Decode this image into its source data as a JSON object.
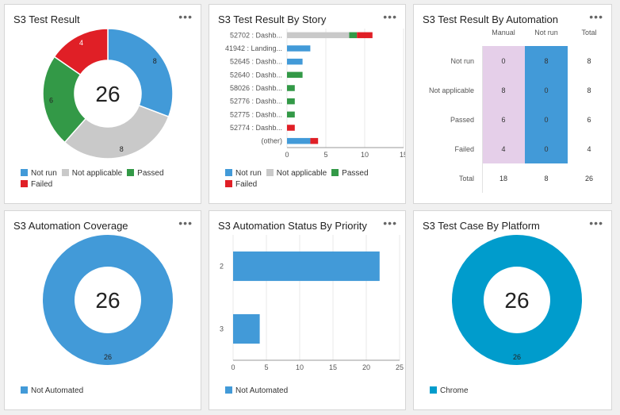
{
  "colors": {
    "not_run": "#429ad8",
    "not_applicable": "#c9c9c9",
    "passed": "#339947",
    "failed": "#e01f26",
    "not_automated": "#429ad8",
    "chrome": "#009ccc",
    "manual_cell": "#e5cfe9",
    "notrun_cell": "#429ad8"
  },
  "menu_icon": "more-horizontal-icon",
  "tiles": {
    "test_result": {
      "title": "S3 Test Result",
      "total": "26",
      "legend": [
        "Not run",
        "Not applicable",
        "Passed",
        "Failed"
      ]
    },
    "by_story": {
      "title": "S3 Test Result By Story",
      "legend": [
        "Not run",
        "Not applicable",
        "Passed",
        "Failed"
      ]
    },
    "by_automation": {
      "title": "S3 Test Result By Automation",
      "columns": [
        "Manual",
        "Not run",
        "Total"
      ],
      "rows": [
        {
          "label": "Not run",
          "manual": "0",
          "notrun": "8",
          "total": "8"
        },
        {
          "label": "Not applicable",
          "manual": "8",
          "notrun": "0",
          "total": "8"
        },
        {
          "label": "Passed",
          "manual": "6",
          "notrun": "0",
          "total": "6"
        },
        {
          "label": "Failed",
          "manual": "4",
          "notrun": "0",
          "total": "4"
        }
      ],
      "totals": {
        "label": "Total",
        "manual": "18",
        "notrun": "8",
        "total": "26"
      }
    },
    "coverage": {
      "title": "S3 Automation Coverage",
      "total": "26",
      "legend": [
        "Not Automated"
      ]
    },
    "by_priority": {
      "title": "S3 Automation Status By Priority",
      "legend": [
        "Not Automated"
      ]
    },
    "by_platform": {
      "title": "S3 Test Case By Platform",
      "total": "26",
      "legend": [
        "Chrome"
      ]
    }
  },
  "chart_data": [
    {
      "type": "pie",
      "title": "S3 Test Result",
      "categories": [
        "Not run",
        "Not applicable",
        "Passed",
        "Failed"
      ],
      "values": [
        8,
        8,
        6,
        4
      ],
      "center_label": "26"
    },
    {
      "type": "bar",
      "orientation": "horizontal",
      "stacked": true,
      "title": "S3 Test Result By Story",
      "categories": [
        "52702 : Dashb...",
        "41942 : Landing...",
        "52645 : Dashb...",
        "52640 : Dashb...",
        "58026 : Dashb...",
        "52776 : Dashb...",
        "52775 : Dashb...",
        "52774 : Dashb...",
        "(other)"
      ],
      "series": [
        {
          "name": "Not run",
          "values": [
            0,
            3,
            2,
            0,
            0,
            0,
            0,
            0,
            3
          ]
        },
        {
          "name": "Not applicable",
          "values": [
            8,
            0,
            0,
            0,
            0,
            0,
            0,
            0,
            0
          ]
        },
        {
          "name": "Passed",
          "values": [
            1,
            0,
            0,
            2,
            1,
            1,
            1,
            0,
            0
          ]
        },
        {
          "name": "Failed",
          "values": [
            2,
            0,
            0,
            0,
            0,
            0,
            0,
            1,
            1
          ]
        }
      ],
      "xlim": [
        0,
        15
      ],
      "xticks": [
        "0",
        "5",
        "10",
        "15"
      ],
      "grid": true
    },
    {
      "type": "table",
      "title": "S3 Test Result By Automation",
      "columns": [
        "Manual",
        "Not run",
        "Total"
      ],
      "rows": [
        "Not run",
        "Not applicable",
        "Passed",
        "Failed",
        "Total"
      ],
      "values": [
        [
          0,
          8,
          8
        ],
        [
          8,
          0,
          8
        ],
        [
          6,
          0,
          6
        ],
        [
          4,
          0,
          4
        ],
        [
          18,
          8,
          26
        ]
      ]
    },
    {
      "type": "pie",
      "title": "S3 Automation Coverage",
      "categories": [
        "Not Automated"
      ],
      "values": [
        26
      ],
      "center_label": "26"
    },
    {
      "type": "bar",
      "orientation": "horizontal",
      "title": "S3 Automation Status By Priority",
      "categories": [
        "2",
        "3"
      ],
      "series": [
        {
          "name": "Not Automated",
          "values": [
            22,
            4
          ]
        }
      ],
      "xlim": [
        0,
        25
      ],
      "xticks": [
        "0",
        "5",
        "10",
        "15",
        "20",
        "25"
      ],
      "grid": true
    },
    {
      "type": "pie",
      "title": "S3 Test Case By Platform",
      "categories": [
        "Chrome"
      ],
      "values": [
        26
      ],
      "center_label": "26"
    }
  ]
}
